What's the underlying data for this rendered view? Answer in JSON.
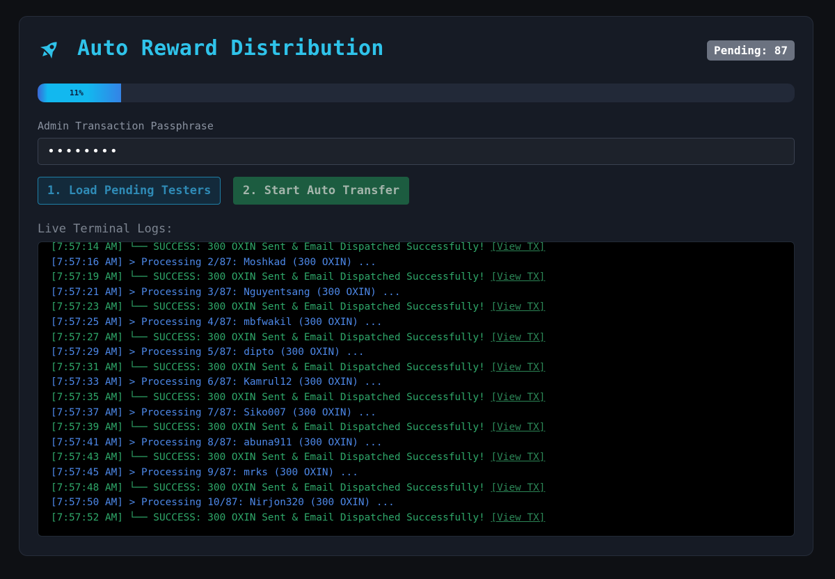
{
  "header": {
    "icon": "rocket-icon",
    "title": "Auto Reward Distribution",
    "pending_badge": "Pending: 87"
  },
  "progress": {
    "percent": 11,
    "label": "11%"
  },
  "passphrase": {
    "label": "Admin Transaction Passphrase",
    "value": "••••••••"
  },
  "buttons": {
    "load": "1. Load Pending Testers",
    "start": "2. Start Auto Transfer"
  },
  "logs": {
    "label": "Live Terminal Logs:",
    "link_text": "[View TX]",
    "lines": [
      {
        "type": "success",
        "text": "[7:57:14 AM] └── SUCCESS: 300 OXIN Sent & Email Dispatched Successfully! "
      },
      {
        "type": "process",
        "text": "[7:57:16 AM] > Processing 2/87: Moshkad (300 OXIN) ..."
      },
      {
        "type": "success",
        "text": "[7:57:19 AM] └── SUCCESS: 300 OXIN Sent & Email Dispatched Successfully! "
      },
      {
        "type": "process",
        "text": "[7:57:21 AM] > Processing 3/87: Nguyentsang (300 OXIN) ..."
      },
      {
        "type": "success",
        "text": "[7:57:23 AM] └── SUCCESS: 300 OXIN Sent & Email Dispatched Successfully! "
      },
      {
        "type": "process",
        "text": "[7:57:25 AM] > Processing 4/87: mbfwakil (300 OXIN) ..."
      },
      {
        "type": "success",
        "text": "[7:57:27 AM] └── SUCCESS: 300 OXIN Sent & Email Dispatched Successfully! "
      },
      {
        "type": "process",
        "text": "[7:57:29 AM] > Processing 5/87: dipto (300 OXIN) ..."
      },
      {
        "type": "success",
        "text": "[7:57:31 AM] └── SUCCESS: 300 OXIN Sent & Email Dispatched Successfully! "
      },
      {
        "type": "process",
        "text": "[7:57:33 AM] > Processing 6/87: Kamrul12 (300 OXIN) ..."
      },
      {
        "type": "success",
        "text": "[7:57:35 AM] └── SUCCESS: 300 OXIN Sent & Email Dispatched Successfully! "
      },
      {
        "type": "process",
        "text": "[7:57:37 AM] > Processing 7/87: Siko007 (300 OXIN) ..."
      },
      {
        "type": "success",
        "text": "[7:57:39 AM] └── SUCCESS: 300 OXIN Sent & Email Dispatched Successfully! "
      },
      {
        "type": "process",
        "text": "[7:57:41 AM] > Processing 8/87: abuna911 (300 OXIN) ..."
      },
      {
        "type": "success",
        "text": "[7:57:43 AM] └── SUCCESS: 300 OXIN Sent & Email Dispatched Successfully! "
      },
      {
        "type": "process",
        "text": "[7:57:45 AM] > Processing 9/87: mrks (300 OXIN) ..."
      },
      {
        "type": "success",
        "text": "[7:57:48 AM] └── SUCCESS: 300 OXIN Sent & Email Dispatched Successfully! "
      },
      {
        "type": "process",
        "text": "[7:57:50 AM] > Processing 10/87: Nirjon320 (300 OXIN) ..."
      },
      {
        "type": "success",
        "text": "[7:57:52 AM] └── SUCCESS: 300 OXIN Sent & Email Dispatched Successfully! "
      }
    ]
  },
  "colors": {
    "accent": "#2fc3ea",
    "success": "#2fa86a",
    "process": "#4d88e8",
    "start_button": "#1c5c40"
  }
}
